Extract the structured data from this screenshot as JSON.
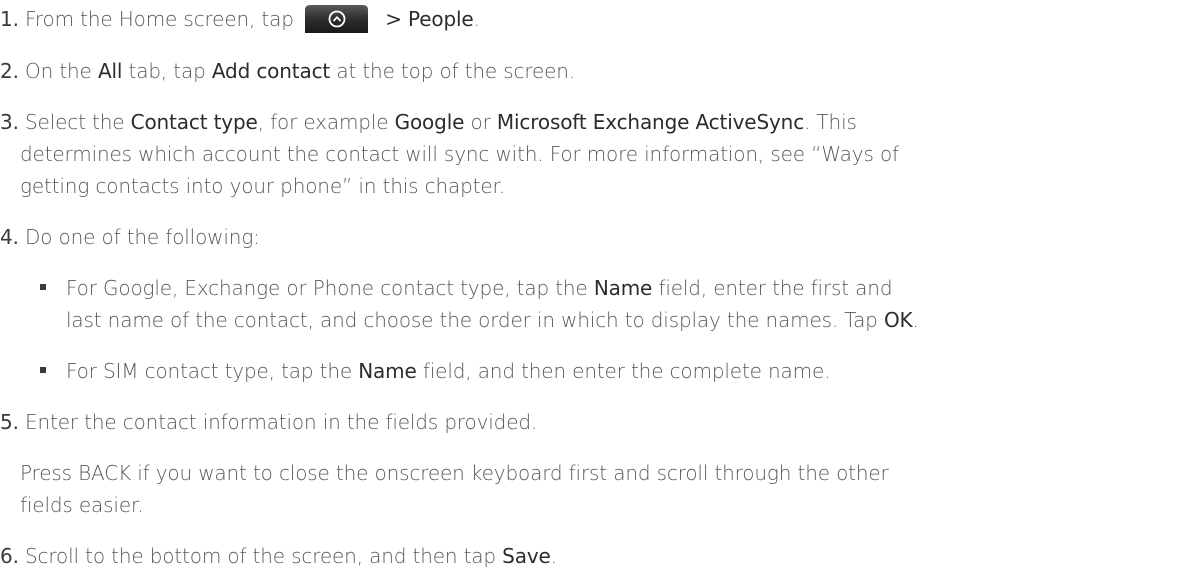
{
  "steps": [
    {
      "num": "1.",
      "a": "From the Home screen, tap",
      "b": "> People",
      "c": "."
    },
    {
      "num": "2.",
      "a": "On the",
      "b": "All",
      "c": "tab, tap",
      "d": "Add contact",
      "e": "at the top of the screen."
    },
    {
      "num": "3.",
      "a": "Select the",
      "b": "Contact type",
      "c": ", for example",
      "d": "Google",
      "e": "or",
      "f": "Microsoft Exchange ActiveSync",
      "g": ". This",
      "line2": "determines which account the contact will sync with. For more information, see “Ways of",
      "line3": "getting contacts into your phone” in this chapter."
    },
    {
      "num": "4.",
      "a": "Do one of the following:"
    },
    {
      "num": "5.",
      "a": "Enter the contact information in the fields provided."
    },
    {
      "num": "6.",
      "a": "Scroll to the bottom of the screen, and then tap",
      "b": "Save",
      "c": "."
    }
  ],
  "bullets": [
    {
      "a": "For Google, Exchange or Phone contact type, tap the",
      "b": "Name",
      "c": "field, enter the first and",
      "line2a": "last name of the contact, and choose the order in which to display the names. Tap",
      "line2b": "OK",
      "line2c": "."
    },
    {
      "a": "For SIM contact type, tap the",
      "b": "Name",
      "c": "field, and then enter the complete name."
    }
  ],
  "note": {
    "line1": "Press BACK if you want to close the onscreen keyboard first and scroll through the other",
    "line2": "fields easier."
  },
  "icons": {
    "launch_button": "all-apps-launch-icon"
  }
}
